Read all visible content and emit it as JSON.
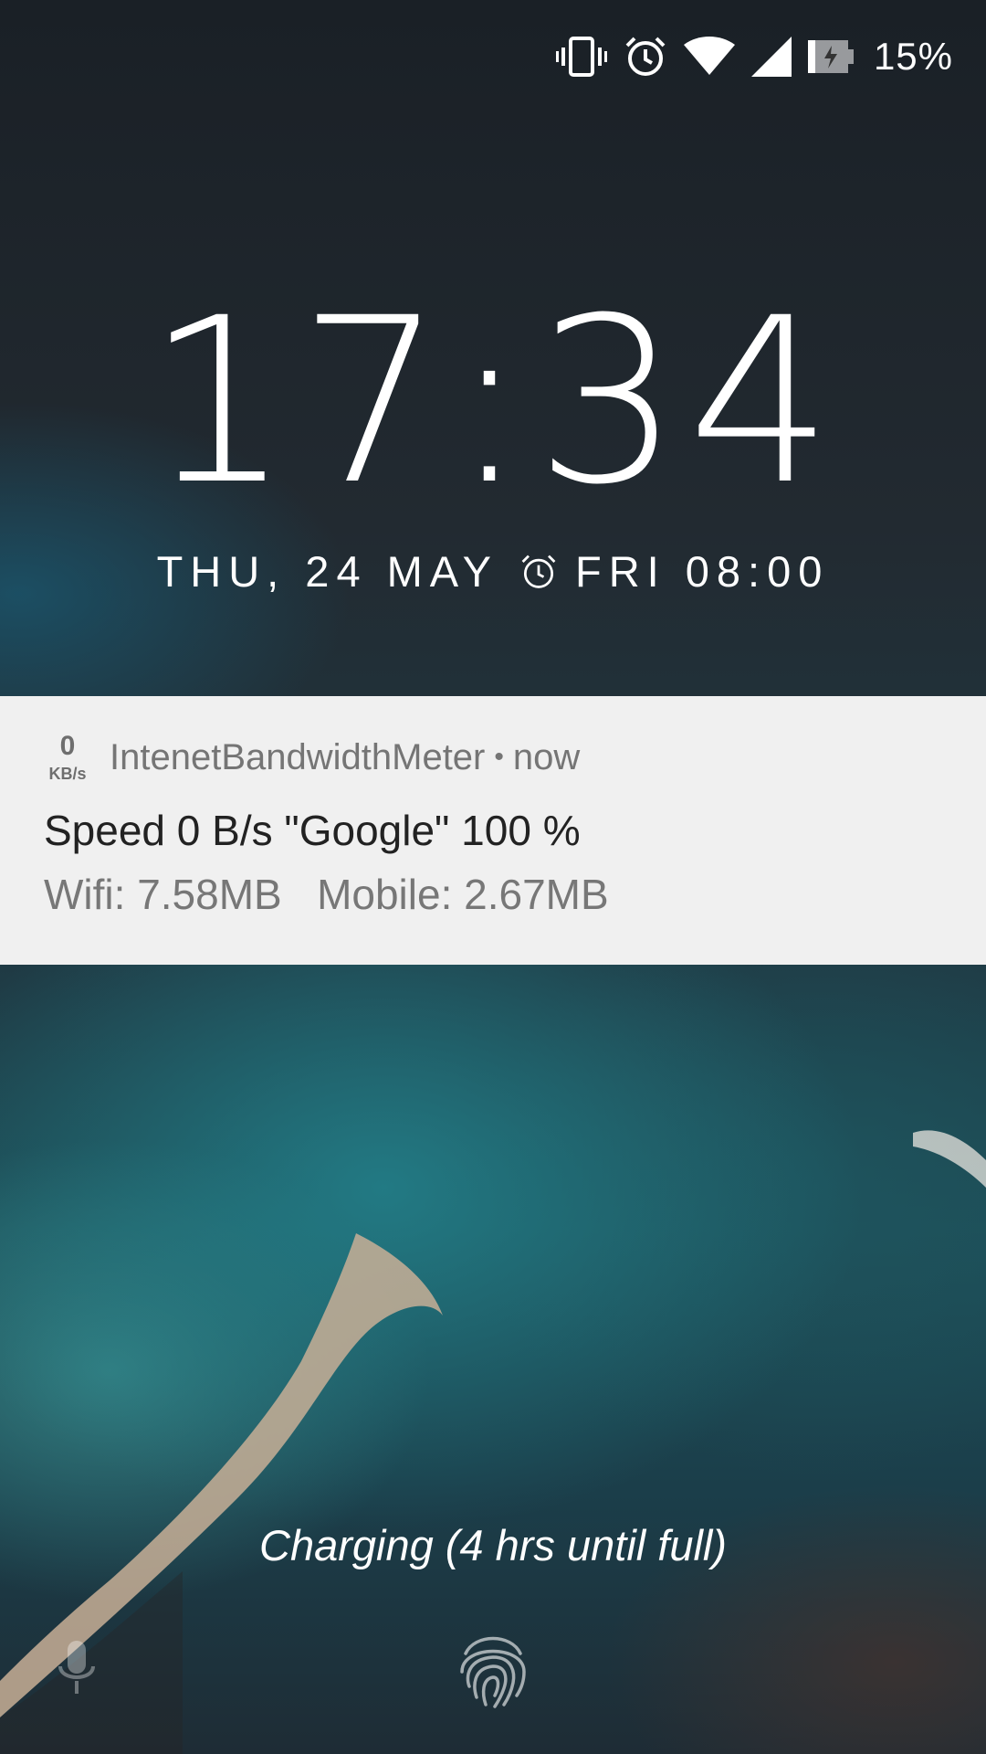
{
  "status_bar": {
    "icons": [
      "vibrate-icon",
      "alarm-icon",
      "wifi-icon",
      "cell-signal-icon",
      "battery-charging-icon"
    ],
    "battery_percent": "15%"
  },
  "lockscreen": {
    "time": "17:34",
    "date": "THU, 24 MAY",
    "next_alarm": "FRI 08:00",
    "charging_text": "Charging (4 hrs until full)"
  },
  "notification": {
    "badge_value": "0",
    "badge_unit": "KB/s",
    "app_name": "IntenetBandwidthMeter",
    "separator": "•",
    "time": "now",
    "title": "Speed 0 B/s \"Google\" 100 %",
    "body": "Wifi: 7.58MB   Mobile: 2.67MB"
  },
  "bottom_icons": [
    "mic-icon",
    "fingerprint-icon"
  ],
  "colors": {
    "notification_bg": "#f0f0f0",
    "notification_title": "#222222",
    "notification_secondary": "#757575",
    "text_on_wallpaper": "#ffffff"
  }
}
